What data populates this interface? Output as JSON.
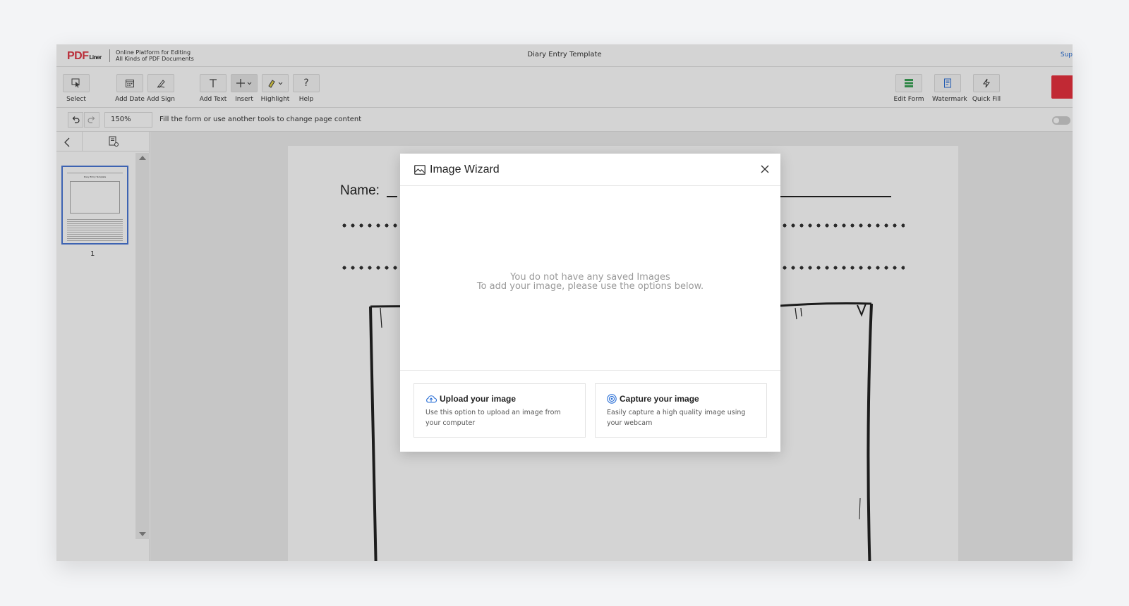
{
  "app": {
    "logo_main": "PDF",
    "logo_sub": "Liner",
    "tagline_line1": "Online Platform for Editing",
    "tagline_line2": "All Kinds of PDF Documents",
    "document_title": "Diary Entry Template",
    "support_label": "Sup"
  },
  "toolbar": {
    "left_tools": [
      {
        "label": "Select",
        "icon": "select-cursor-icon"
      },
      {
        "label": "Add Date",
        "icon": "calendar-icon"
      },
      {
        "label": "Add Sign",
        "icon": "pen-icon"
      },
      {
        "label": "Add Text",
        "icon": "text-icon"
      },
      {
        "label": "Insert",
        "icon": "plus-icon"
      },
      {
        "label": "Highlight",
        "icon": "highlighter-icon"
      },
      {
        "label": "Help",
        "icon": "question-icon"
      }
    ],
    "right_tools": [
      {
        "label": "Edit Form",
        "icon": "form-icon",
        "color": "#3aa356"
      },
      {
        "label": "Watermark",
        "icon": "watermark-icon",
        "color": "#2a6fd6"
      },
      {
        "label": "Quick Fill",
        "icon": "lightning-icon",
        "color": "#333333"
      }
    ],
    "accent_red": "#e8323f"
  },
  "subbar": {
    "zoom": "150%",
    "hint": "Fill the form or use another tools to change page content"
  },
  "sidebar": {
    "page_numbers": [
      "1"
    ],
    "thumb_title": "Diary Entry Template"
  },
  "document": {
    "name_label": "Name:"
  },
  "modal": {
    "title": "Image Wizard",
    "empty_line1": "You do not have any saved Images",
    "empty_line2": "To add your image, please use the options below.",
    "upload": {
      "title": "Upload your image",
      "desc": "Use this option to upload an image from your computer"
    },
    "capture": {
      "title": "Capture your image",
      "desc": "Easily capture a high quality image using your webcam"
    }
  }
}
